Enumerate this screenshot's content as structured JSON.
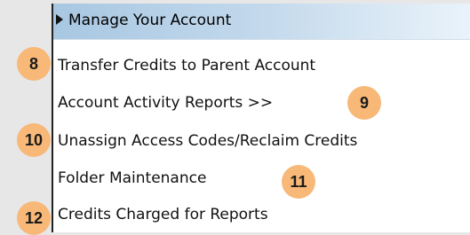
{
  "menu": {
    "header_label": "Manage Your Account",
    "items": [
      {
        "label": "Transfer Credits to Parent Account"
      },
      {
        "label": "Account Activity Reports >>"
      },
      {
        "label": "Unassign Access Codes/Reclaim Credits"
      },
      {
        "label": "Folder Maintenance"
      },
      {
        "label": "Credits Charged for Reports"
      }
    ]
  },
  "callouts": [
    "8",
    "9",
    "10",
    "11",
    "12"
  ],
  "colors": {
    "background": "#e7e7e7",
    "panel": "#ffffff",
    "header_gradient_start": "#a8c7e2",
    "header_gradient_end": "#eaf3fa",
    "callout_fill": "#f7b878"
  }
}
